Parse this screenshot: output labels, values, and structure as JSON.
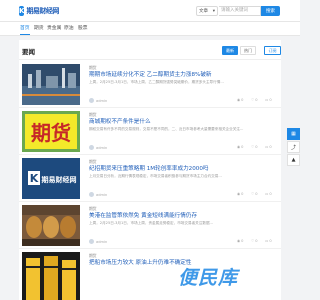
{
  "header": {
    "logo_glyph": "K",
    "logo_text": "期易财经网",
    "search_select": "文章",
    "search_placeholder": "请输入关键词",
    "search_button": "搜索"
  },
  "nav": {
    "items": [
      "首页",
      "期货",
      "贵金属",
      "原油",
      "股票"
    ]
  },
  "panel": {
    "title": "要闻",
    "sort_new": "最新",
    "sort_hot": "热门",
    "subscribe": "订阅"
  },
  "articles": [
    {
      "category": "期货",
      "title": "期期市场延续分化不定 乙二醇期货主力涨8%破新",
      "excerpt": "上周，2月25日-3月1日，市场上周，乙二醇期货强势突破期价，期货多头主导行情...",
      "author": "admin",
      "views": "0",
      "likes": "0",
      "comments": "0"
    },
    {
      "category": "期货",
      "title": "商城期权不产条件是什么",
      "excerpt": "期权交易有许多不同的交易规则，交易不是不同的，二、近日市场参考大量需要来相关企业关注...",
      "author": "admin",
      "views": "0",
      "likes": "0",
      "comments": "0"
    },
    {
      "category": "期货",
      "title": "纪招期货来压重策略期 1M轮创率率成力2000吗",
      "excerpt": "上月交易日分析，近期行情表现稳定，市场交易者积极参与期货市场主力合约交易...",
      "author": "admin",
      "views": "0",
      "likes": "0",
      "comments": "0"
    },
    {
      "category": "期货",
      "title": "美港在监管策依然免 黄金短线满能行情仍存",
      "excerpt": "上周，2月25日-3月1日，市场上周，贵金属走势稳定，市场交易者关注数据...",
      "author": "admin",
      "views": "0",
      "likes": "0",
      "comments": "0"
    },
    {
      "category": "期货",
      "title": "把船市场压力较大 原油上升仍难不确定性",
      "excerpt": "",
      "author": "",
      "views": "",
      "likes": "",
      "comments": ""
    }
  ],
  "thumbs": [
    {
      "kind": "factory",
      "bg": "#2f4b6b"
    },
    {
      "kind": "futures-sign",
      "bg": "#f4e92a",
      "text": "期货"
    },
    {
      "kind": "logo",
      "bg": "#1d4a7e",
      "text": "期易财经网"
    },
    {
      "kind": "tanks",
      "bg": "#7c5a3b"
    },
    {
      "kind": "barrels",
      "bg": "#1a1a1a"
    }
  ],
  "watermark": "便民库",
  "colors": {
    "accent": "#1e88e5",
    "link": "#1e5db8"
  }
}
